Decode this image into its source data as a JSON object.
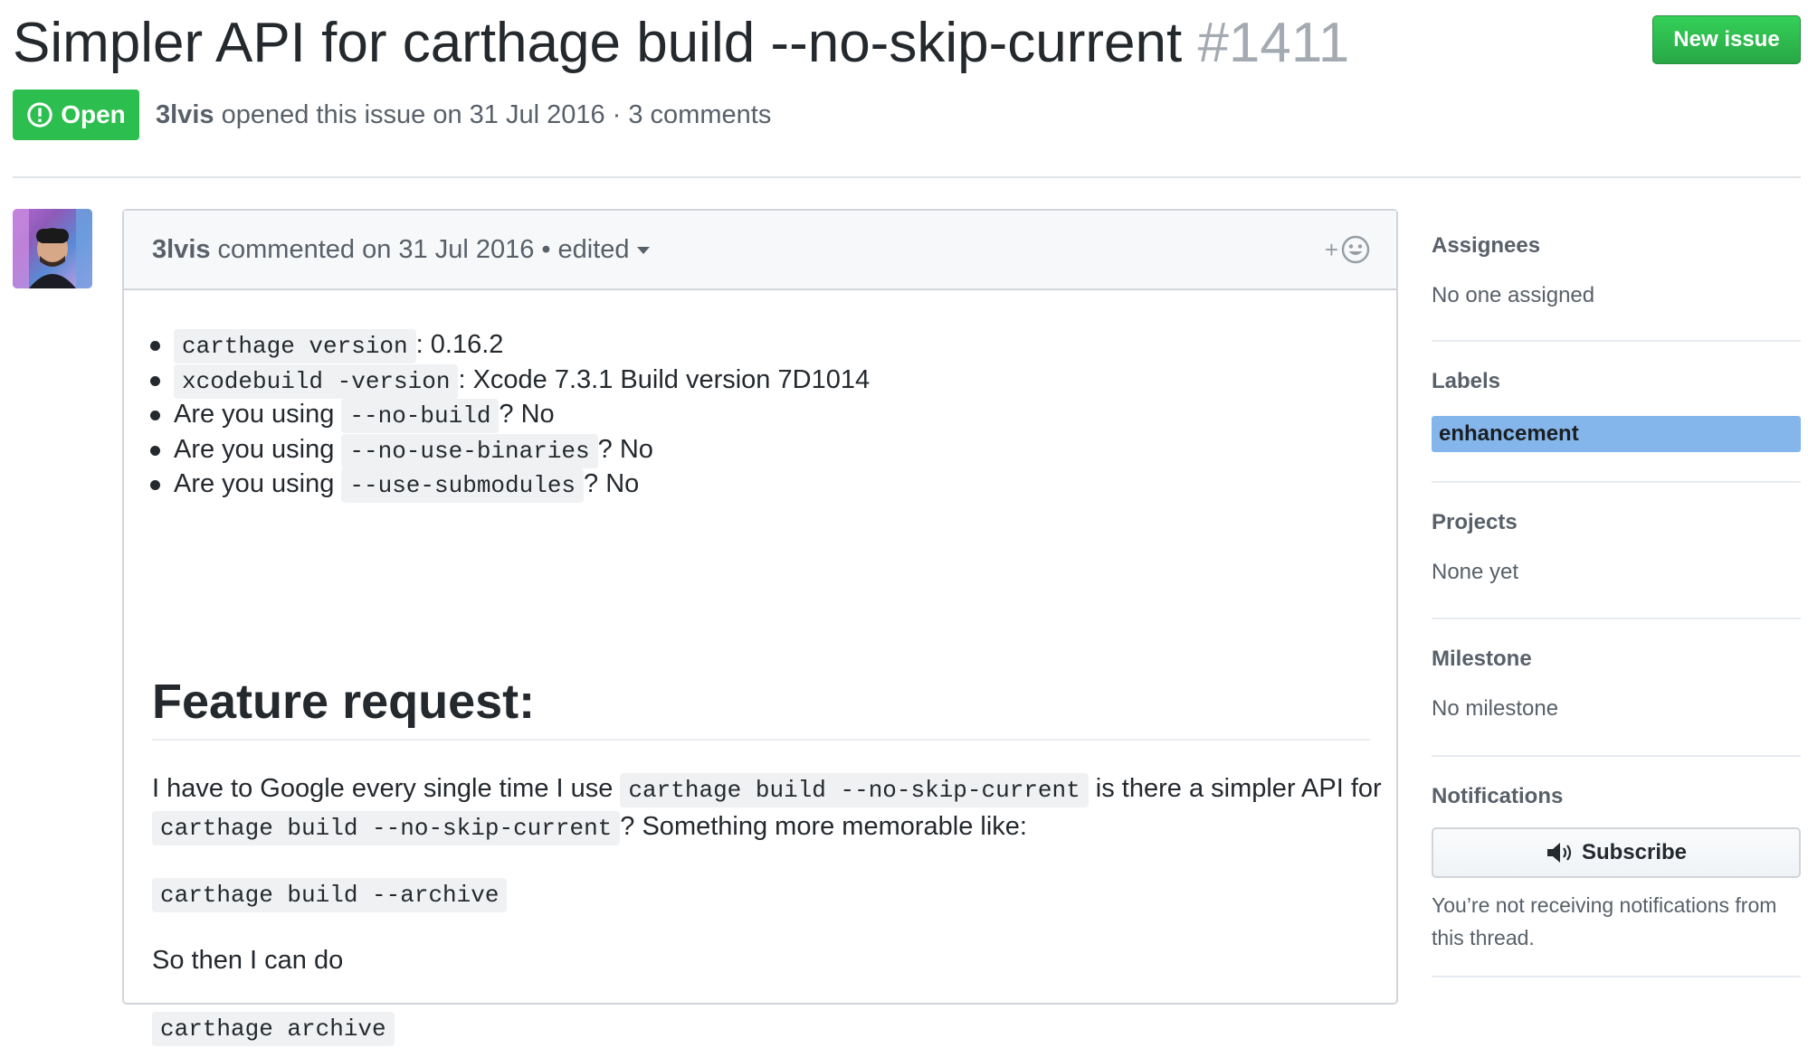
{
  "issue": {
    "title": "Simpler API for carthage build --no-skip-current",
    "number": "#1411",
    "state": "Open",
    "author": "3lvis",
    "opened_text": "opened this issue on 31 Jul 2016 · 3 comments",
    "new_issue_label": "New issue"
  },
  "comment": {
    "author": "3lvis",
    "date_text": "commented on 31 Jul 2016",
    "bullet": "•",
    "edited_label": "edited",
    "reaction_plus": "+",
    "list": [
      {
        "prefix": "",
        "code": "carthage version",
        "suffix": ": 0.16.2"
      },
      {
        "prefix": "",
        "code": "xcodebuild -version",
        "suffix": ": Xcode 7.3.1 Build version 7D1014"
      },
      {
        "prefix": "Are you using",
        "code": "--no-build",
        "suffix": "? No"
      },
      {
        "prefix": "Are you using",
        "code": "--no-use-binaries",
        "suffix": "? No"
      },
      {
        "prefix": "Are you using",
        "code": "--use-submodules",
        "suffix": "? No"
      }
    ],
    "heading": "Feature request:",
    "para1_text1": "I have to Google every single time I use",
    "para1_code1": "carthage build --no-skip-current",
    "para1_text2": "is there a simpler API for",
    "para1_code2": "carthage build --no-skip-current",
    "para1_text3": "? Something more memorable like:",
    "code_block1": "carthage build --archive",
    "para2": "So then I can do",
    "code_block2": "carthage archive"
  },
  "sidebar": {
    "assignees_title": "Assignees",
    "assignees_value": "No one assigned",
    "labels_title": "Labels",
    "label": "enhancement",
    "label_color": "#84b6eb",
    "projects_title": "Projects",
    "projects_value": "None yet",
    "milestone_title": "Milestone",
    "milestone_value": "No milestone",
    "notifications_title": "Notifications",
    "subscribe_label": "Subscribe",
    "notice": "You’re not receiving notifications from this thread."
  }
}
